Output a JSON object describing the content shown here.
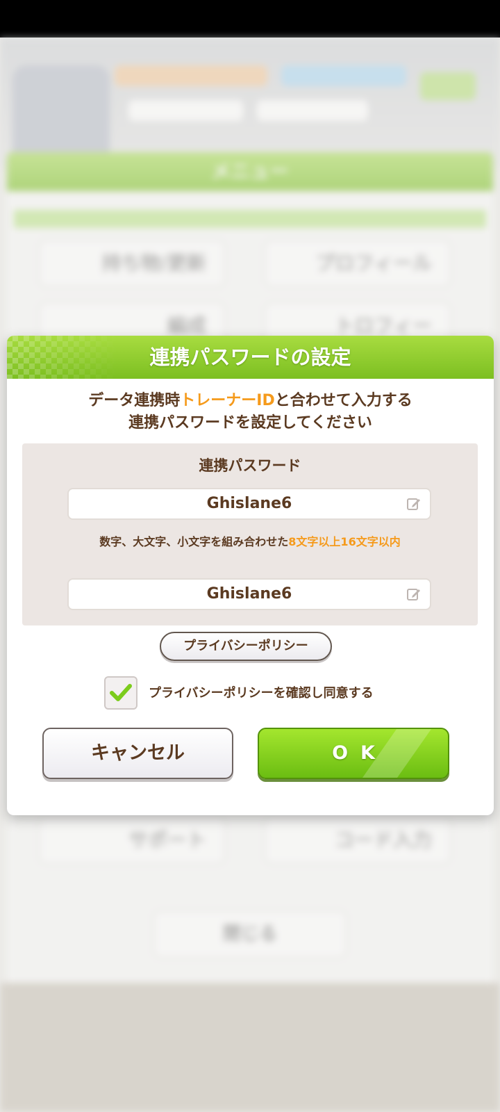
{
  "background": {
    "menu_title": "メニュー",
    "tiles": [
      "持ち物/更新",
      "プロフィール",
      "編成",
      "トロフィー",
      "サポート",
      "コード入力"
    ],
    "close_label": "閉じる"
  },
  "dialog": {
    "title": "連携パスワードの設定",
    "description": {
      "line1_pre": "データ連携時",
      "line1_highlight": "トレーナーID",
      "line1_post": "と合わせて入力する",
      "line2": "連携パスワードを設定してください"
    },
    "field_label": "連携パスワード",
    "password_value": "Ghislane6",
    "confirm_value": "Ghislane6",
    "hint": {
      "pre": "数字、大文字、小文字を組み合わせた",
      "highlight": "8文字以上16文字以内"
    },
    "privacy_button": "プライバシーポリシー",
    "agree_label": "プライバシーポリシーを確認し同意する",
    "agree_checked": true,
    "cancel_label": "キャンセル",
    "ok_label": "OK"
  },
  "colors": {
    "header_green": "#7cbf21",
    "text_brown": "#5b3a21",
    "highlight_orange": "#f59a1b"
  }
}
